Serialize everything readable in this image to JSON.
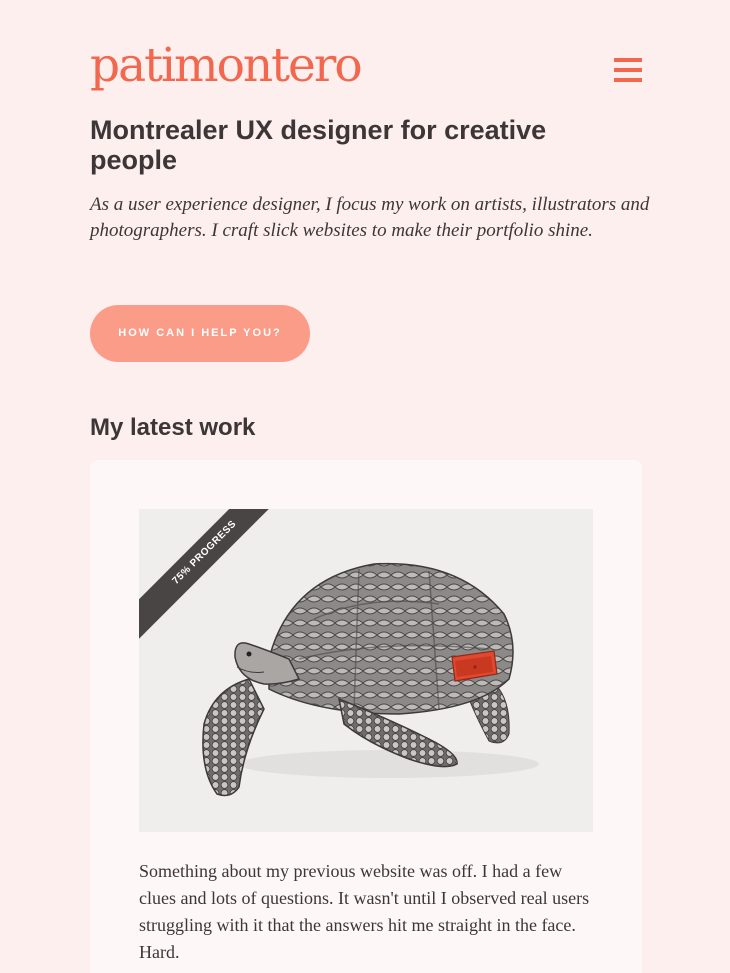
{
  "header": {
    "logo": "patimontero",
    "menu_icon": "hamburger-menu-icon"
  },
  "hero": {
    "headline": "Montrealer UX designer for creative people",
    "intro": "As a user experience designer, I focus my work on artists, illustrators and photographers. I craft slick websites to make their portfolio shine.",
    "cta_label": "HOW CAN I HELP YOU?"
  },
  "work": {
    "title": "My latest work",
    "items": [
      {
        "ribbon": "75% PROGRESS",
        "image_icon": "tortoise-with-drawer-illustration",
        "description": "Something about my previous website was off. I had a few clues and lots of questions. It wasn't until I observed real users struggling with it that the answers hit me straight in the face. Hard."
      }
    ]
  },
  "colors": {
    "background": "#fcefee",
    "accent": "#f2684f",
    "cta": "#fa9c87",
    "text": "#3d3636",
    "card": "#fdf8f7"
  }
}
